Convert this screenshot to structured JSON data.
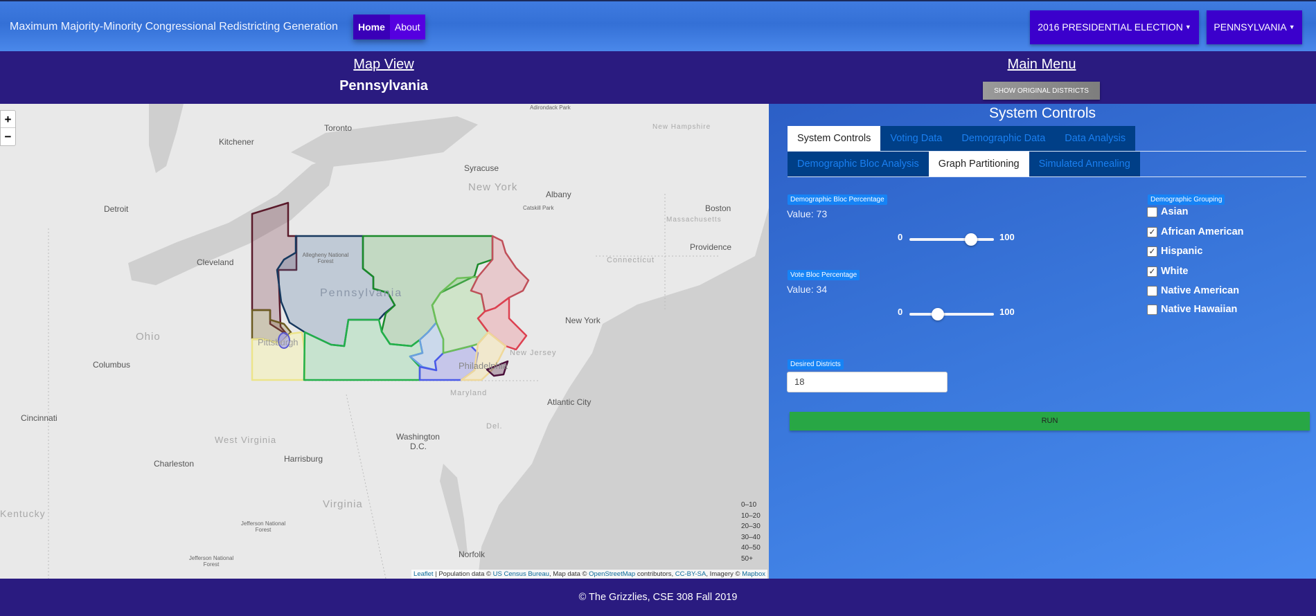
{
  "navbar": {
    "title": "Maximum Majority-Minority Congressional Redistricting Generation",
    "links": [
      "Home",
      "About"
    ],
    "election_dropdown": "2016 PRESIDENTIAL ELECTION",
    "state_dropdown": "PENNSYLVANIA"
  },
  "header": {
    "map_view": "Map View",
    "state_title": "Pennsylvania",
    "main_menu": "Main Menu",
    "show_original": "SHOW ORIGINAL DISTRICTS"
  },
  "map": {
    "zoom_in": "+",
    "zoom_out": "−",
    "cities": [
      "Toronto",
      "Kitchener",
      "Syracuse",
      "Albany",
      "Detroit",
      "Cleveland",
      "Boston",
      "Providence",
      "Columbus",
      "New York",
      "Atlantic City",
      "Cincinnati",
      "Harrisburg",
      "Charleston",
      "Norfolk",
      "Washington",
      "D.C.",
      "Pittsburgh",
      "Philadelphia"
    ],
    "regions": [
      "New York",
      "Pennsylvania",
      "Ohio",
      "West Virginia",
      "Virginia",
      "Kentucky",
      "New Jersey",
      "Maryland",
      "Massachusetts",
      "Connecticut",
      "Del.",
      "New Hampshire"
    ],
    "small_labels": [
      "Adirondack Park",
      "Catskill Park",
      "Allegheny National Forest",
      "Jefferson National Forest",
      "Jefferson National Forest"
    ],
    "legend": [
      "0–10",
      "10–20",
      "20–30",
      "30–40",
      "40–50",
      "50+"
    ],
    "attribution": {
      "leaflet": "Leaflet",
      "t1": " | Population data © ",
      "census": "US Census Bureau",
      "t2": ", Map data © ",
      "osm": "OpenStreetMap",
      "t3": " contributors, ",
      "license": "CC-BY-SA",
      "t4": ", Imagery © ",
      "mapbox": "Mapbox"
    }
  },
  "panel": {
    "title": "System Controls",
    "tabs_row1": [
      "System Controls",
      "Voting Data",
      "Demographic Data",
      "Data Analysis"
    ],
    "tabs_row2": [
      "Demographic Bloc Analysis",
      "Graph Partitioning",
      "Simulated Annealing"
    ],
    "active_tab": "Graph Partitioning",
    "demographic_bloc": {
      "label": "Demographic Bloc Percentage",
      "value_text": "Value: 73",
      "value": 73,
      "min": "0",
      "max": "100"
    },
    "vote_bloc": {
      "label": "Vote Bloc Percentage",
      "value_text": "Value: 34",
      "value": 34,
      "min": "0",
      "max": "100"
    },
    "grouping": {
      "label": "Demographic Grouping",
      "items": [
        {
          "label": "Asian",
          "checked": false
        },
        {
          "label": "African American",
          "checked": true
        },
        {
          "label": "Hispanic",
          "checked": true
        },
        {
          "label": "White",
          "checked": true
        },
        {
          "label": "Native American",
          "checked": false
        },
        {
          "label": "Native Hawaiian",
          "checked": false
        }
      ]
    },
    "desired_districts": {
      "label": "Desired Districts",
      "value": "18"
    },
    "run": "RUN"
  },
  "footer": "© The Grizzlies, CSE 308 Fall 2019"
}
